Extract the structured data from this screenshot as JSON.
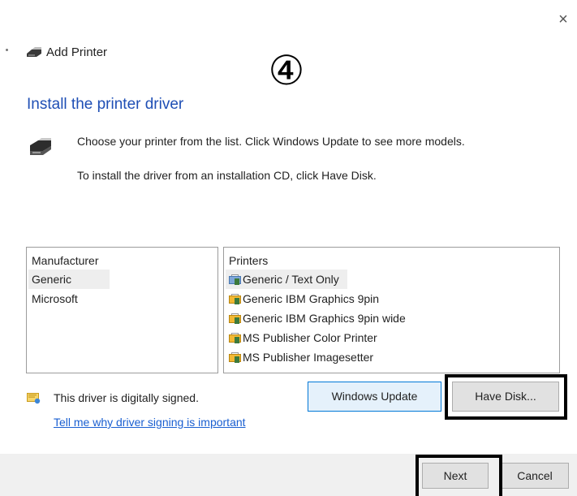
{
  "window": {
    "title": "Add Printer",
    "close_glyph": "×"
  },
  "annotation": {
    "step_marker": "④"
  },
  "main": {
    "heading": "Install the printer driver",
    "description_1": "Choose your printer from the list. Click Windows Update to see more models.",
    "description_2": "To install the driver from an installation CD, click Have Disk."
  },
  "manufacturer_list": {
    "header": "Manufacturer",
    "items": [
      {
        "label": "Generic",
        "selected": true
      },
      {
        "label": "Microsoft",
        "selected": false
      }
    ]
  },
  "printer_list": {
    "header": "Printers",
    "items": [
      {
        "label": "Generic / Text Only",
        "selected": true
      },
      {
        "label": "Generic IBM Graphics 9pin",
        "selected": false
      },
      {
        "label": "Generic IBM Graphics 9pin wide",
        "selected": false
      },
      {
        "label": "MS Publisher Color Printer",
        "selected": false
      },
      {
        "label": "MS Publisher Imagesetter",
        "selected": false
      }
    ]
  },
  "driver_signing": {
    "status_text": "This driver is digitally signed.",
    "link_text": "Tell me why driver signing is important"
  },
  "buttons": {
    "windows_update": "Windows Update",
    "have_disk": "Have Disk...",
    "next": "Next",
    "cancel": "Cancel"
  },
  "colors": {
    "heading": "#1f4fb5",
    "link": "#1a5fd1",
    "focused_button_border": "#0078d7",
    "highlight_box": "#000000"
  }
}
